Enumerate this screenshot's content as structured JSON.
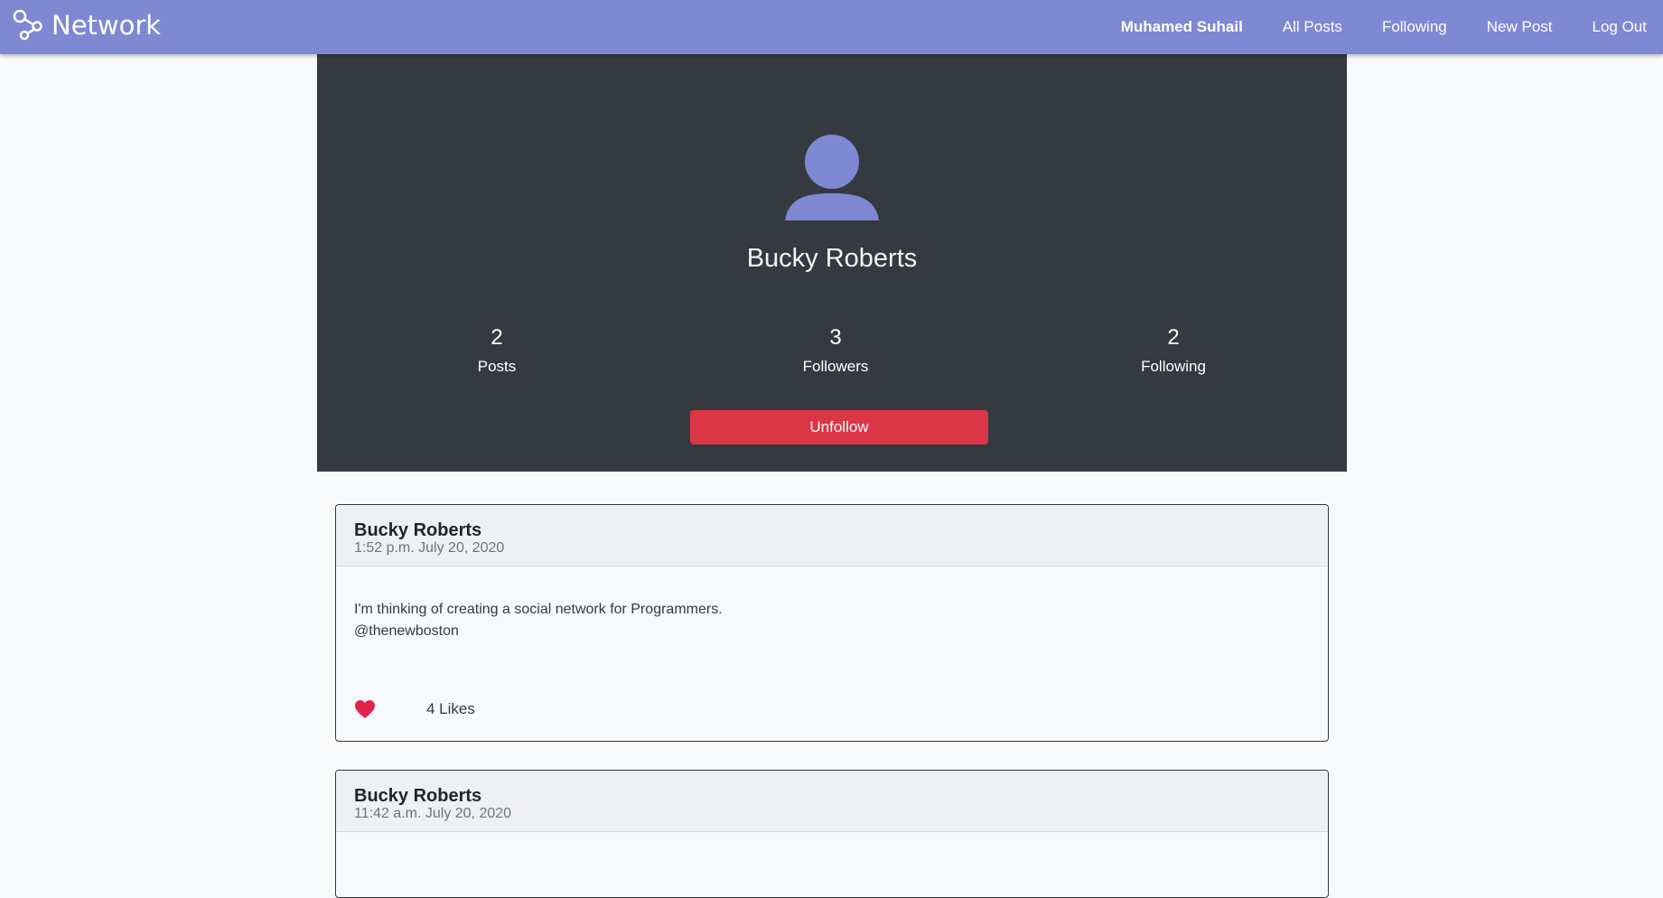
{
  "navbar": {
    "brand": "Network",
    "user": "Muhamed Suhail",
    "links": [
      "All Posts",
      "Following",
      "New Post",
      "Log Out"
    ],
    "color": "#7f88d3"
  },
  "profile": {
    "name": "Bucky Roberts",
    "stats": [
      {
        "count": "2",
        "label": "Posts"
      },
      {
        "count": "3",
        "label": "Followers"
      },
      {
        "count": "2",
        "label": "Following"
      }
    ],
    "action": "Unfollow",
    "avatar_icon": "user-avatar-icon"
  },
  "posts": [
    {
      "author": "Bucky Roberts",
      "time": "1:52 p.m. July 20, 2020",
      "lines": [
        "I'm thinking of creating a social network for Programmers.",
        "@thenewboston"
      ],
      "likes": "4 Likes",
      "liked": true
    },
    {
      "author": "Bucky Roberts",
      "time": "11:42 a.m. July 20, 2020"
    }
  ]
}
